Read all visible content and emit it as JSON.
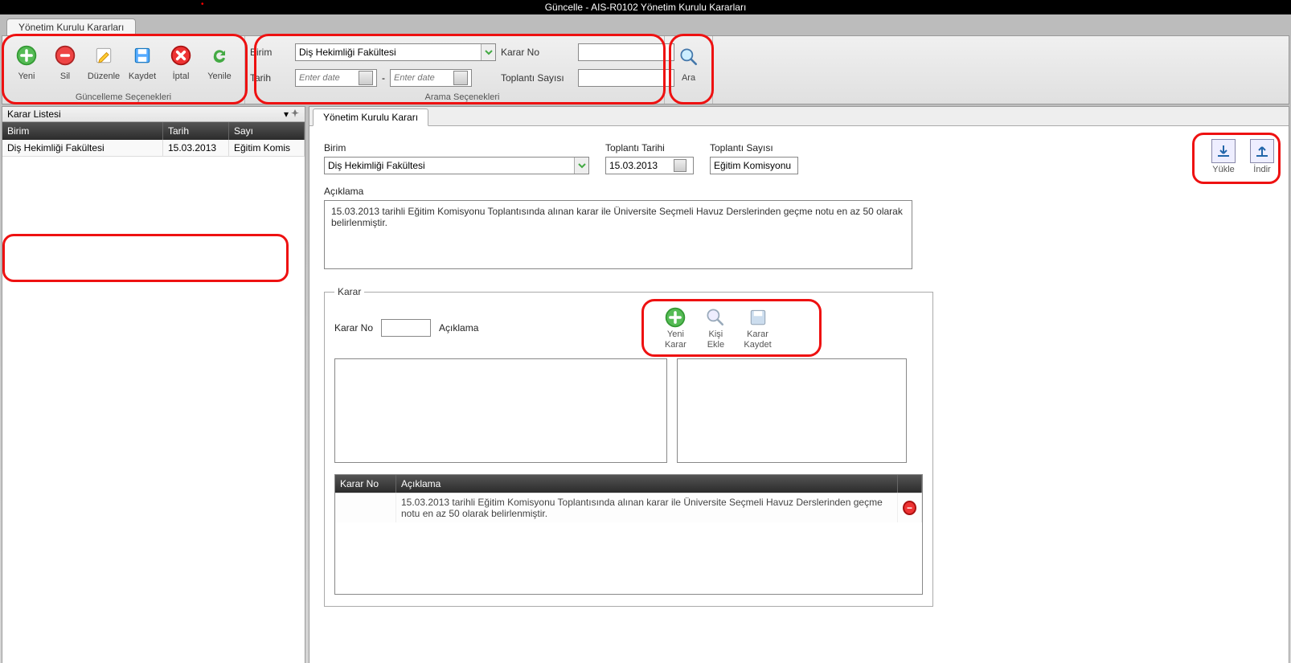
{
  "title": "Güncelle - AIS-R0102 Yönetim Kurulu Kararları",
  "main_tab": "Yönetim Kurulu Kararları",
  "ribbon": {
    "update": {
      "title": "Güncelleme Seçenekleri",
      "yeni": "Yeni",
      "sil": "Sil",
      "duzenle": "Düzenle",
      "kaydet": "Kaydet",
      "iptal": "İptal",
      "yenile": "Yenile"
    },
    "search": {
      "title": "Arama Seçenekleri",
      "birim_label": "Birim",
      "birim_value": "Diş Hekimliği Fakültesi",
      "tarih_label": "Tarih",
      "date_placeholder": "Enter date",
      "kararno_label": "Karar No",
      "kararno_value": "",
      "toplanti_label": "Toplantı Sayısı",
      "toplanti_value": ""
    },
    "ara_label": "Ara"
  },
  "left": {
    "title": "Karar Listesi",
    "cols": {
      "birim": "Birim",
      "tarih": "Tarih",
      "sayi": "Sayı"
    },
    "row": {
      "birim": "Diş Hekimliği Fakültesi",
      "tarih": "15.03.2013",
      "sayi": "Eğitim Komis"
    }
  },
  "right": {
    "tab": "Yönetim Kurulu Kararı",
    "birim_label": "Birim",
    "birim_value": "Diş Hekimliği Fakültesi",
    "tarih_label": "Toplantı Tarihi",
    "tarih_value": "15.03.2013",
    "sayi_label": "Toplantı Sayısı",
    "sayi_value": "Eğitim Komisyonu",
    "yukle": "Yükle",
    "indir": "İndir",
    "aciklama_label": "Açıklama",
    "aciklama_text": "15.03.2013 tarihli Eğitim Komisyonu Toplantısında alınan karar ile Üniversite Seçmeli Havuz Derslerinden geçme notu en az 50 olarak belirlenmiştir.",
    "karar": {
      "legend": "Karar",
      "kararno_label": "Karar No",
      "kararno_value": "",
      "aciklama_label": "Açıklama",
      "yeni_karar": "Yeni\nKarar",
      "kisi_ekle": "Kişi\nEkle",
      "karar_kaydet": "Karar\nKaydet",
      "grid": {
        "kno": "Karar No",
        "ack": "Açıklama",
        "row_ack": "15.03.2013 tarihli Eğitim Komisyonu Toplantısında alınan karar ile Üniversite Seçmeli Havuz Derslerinden geçme notu en az 50 olarak belirlenmiştir."
      }
    }
  }
}
